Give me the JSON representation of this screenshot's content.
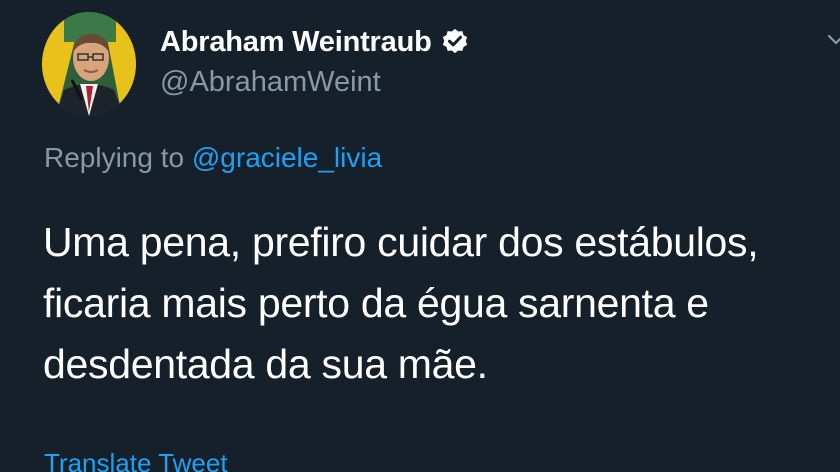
{
  "author": {
    "display_name": "Abraham Weintraub",
    "handle": "@AbrahamWeint",
    "verified": true,
    "avatar_icon": "user-avatar"
  },
  "reply": {
    "prefix": "Replying to",
    "mention": "@graciele_livia"
  },
  "tweet": {
    "lines": [
      "Uma pena, prefiro cuidar dos estábulos,",
      "ficaria mais perto da égua sarnenta e",
      "desdentada da sua mãe."
    ]
  },
  "actions": {
    "translate_label": "Translate Tweet"
  },
  "colors": {
    "background": "#15202b",
    "primary_text": "#ffffff",
    "secondary_text": "#8899a6",
    "accent": "#1da1f2"
  }
}
